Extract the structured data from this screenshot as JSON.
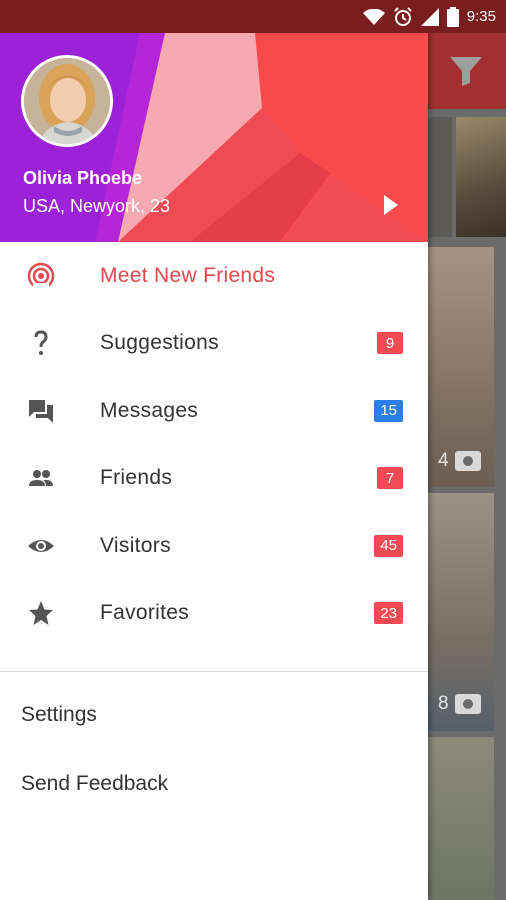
{
  "status_bar": {
    "time": "9:35",
    "icons": [
      "wifi-icon",
      "alarm-icon",
      "signal-icon",
      "battery-icon"
    ],
    "background": "#7a1d1e"
  },
  "profile": {
    "name": "Olivia Phoebe",
    "details": "USA, Newyork, 23",
    "avatar": "profile-photo",
    "header_colors": [
      "#9b22d6",
      "#c52ad8",
      "#f6a8b0",
      "#f74a4d"
    ]
  },
  "menu": {
    "items": [
      {
        "label": "Meet New Friends",
        "icon": "radar-icon",
        "badge": null,
        "active": true
      },
      {
        "label": "Suggestions",
        "icon": "question-icon",
        "badge": "9",
        "badge_color": "#f04b54"
      },
      {
        "label": "Messages",
        "icon": "chat-icon",
        "badge": "15",
        "badge_color": "#2a7fe6"
      },
      {
        "label": "Friends",
        "icon": "people-icon",
        "badge": "7",
        "badge_color": "#f04b54"
      },
      {
        "label": "Visitors",
        "icon": "eye-icon",
        "badge": "45",
        "badge_color": "#f04b54"
      },
      {
        "label": "Favorites",
        "icon": "star-icon",
        "badge": "23",
        "badge_color": "#f04b54"
      }
    ],
    "accent": "#e0494e"
  },
  "secondary": {
    "settings": "Settings",
    "feedback": "Send Feedback"
  },
  "background_app": {
    "photo_counts": [
      "4",
      "8"
    ]
  }
}
